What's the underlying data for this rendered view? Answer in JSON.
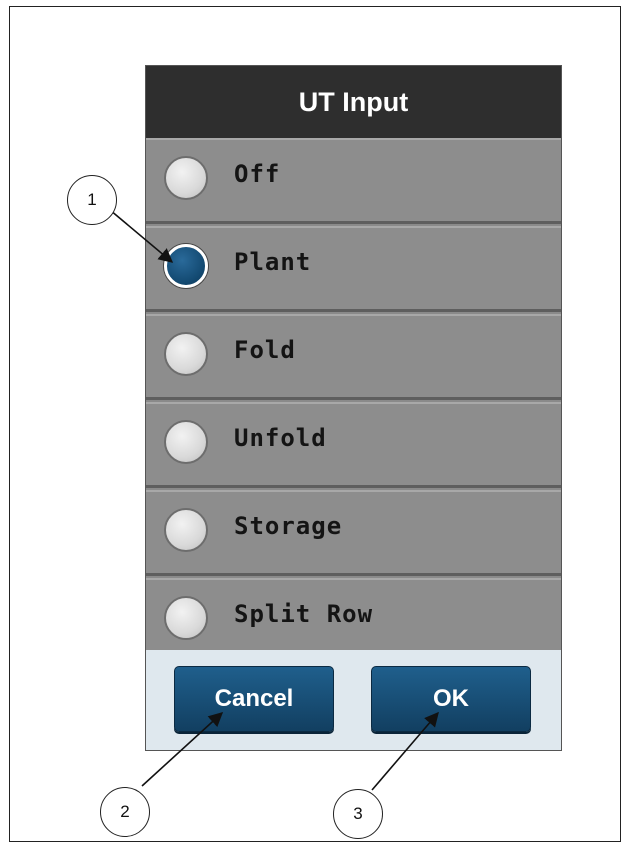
{
  "dialog": {
    "title": "UT Input",
    "options": [
      {
        "label": "Off",
        "selected": false
      },
      {
        "label": "Plant",
        "selected": true
      },
      {
        "label": "Fold",
        "selected": false
      },
      {
        "label": "Unfold",
        "selected": false
      },
      {
        "label": "Storage",
        "selected": false
      },
      {
        "label": "Split Row",
        "selected": false
      }
    ],
    "buttons": {
      "cancel_label": "Cancel",
      "ok_label": "OK"
    }
  },
  "callouts": [
    "1",
    "2",
    "3"
  ],
  "colors": {
    "title_bar": "#2e2e2e",
    "option_bg": "#8d8d8d",
    "button_blue": "#1a5580",
    "selected_radio": "#134a72"
  }
}
